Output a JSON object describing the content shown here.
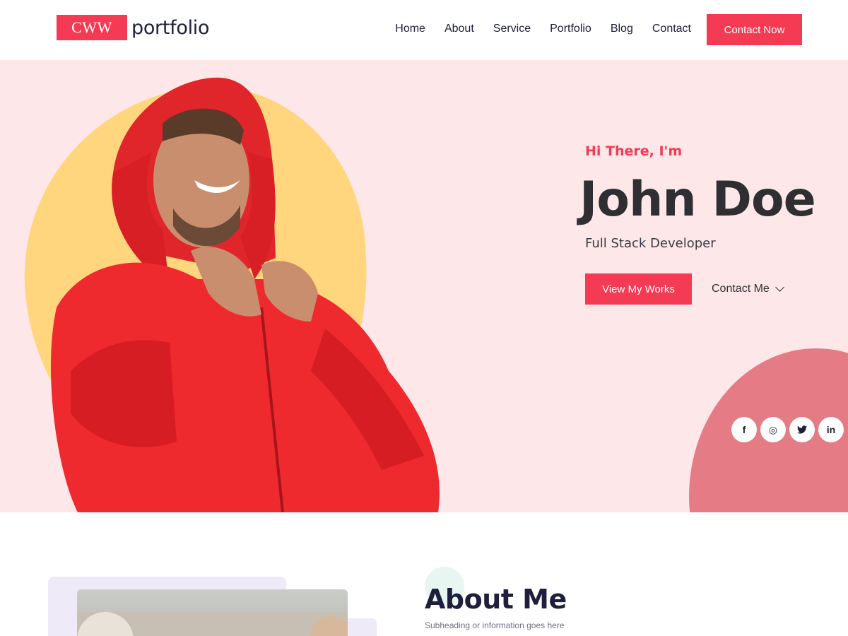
{
  "brand": {
    "box": "CWW",
    "text": "portfolio"
  },
  "nav": {
    "items": [
      "Home",
      "About",
      "Service",
      "Portfolio",
      "Blog",
      "Contact"
    ],
    "cta": "Contact Now"
  },
  "hero": {
    "greeting": "Hi There, I'm",
    "name": "John Doe",
    "role": "Full Stack Developer",
    "primary_button": "View My Works",
    "secondary_button": "Contact Me",
    "socials": [
      {
        "icon": "facebook-icon",
        "glyph": "f"
      },
      {
        "icon": "instagram-icon",
        "glyph": "◎"
      },
      {
        "icon": "twitter-icon",
        "glyph": "🐦"
      },
      {
        "icon": "linkedin-icon",
        "glyph": "in"
      }
    ]
  },
  "about": {
    "title": "About Me",
    "subtitle": "Subheading or information goes here"
  },
  "colors": {
    "accent": "#f53a53",
    "hero_bg": "#fee7e8",
    "blob_yellow": "#ffd67d",
    "blob_pink": "#e47b85",
    "navy": "#1d1f3c"
  }
}
